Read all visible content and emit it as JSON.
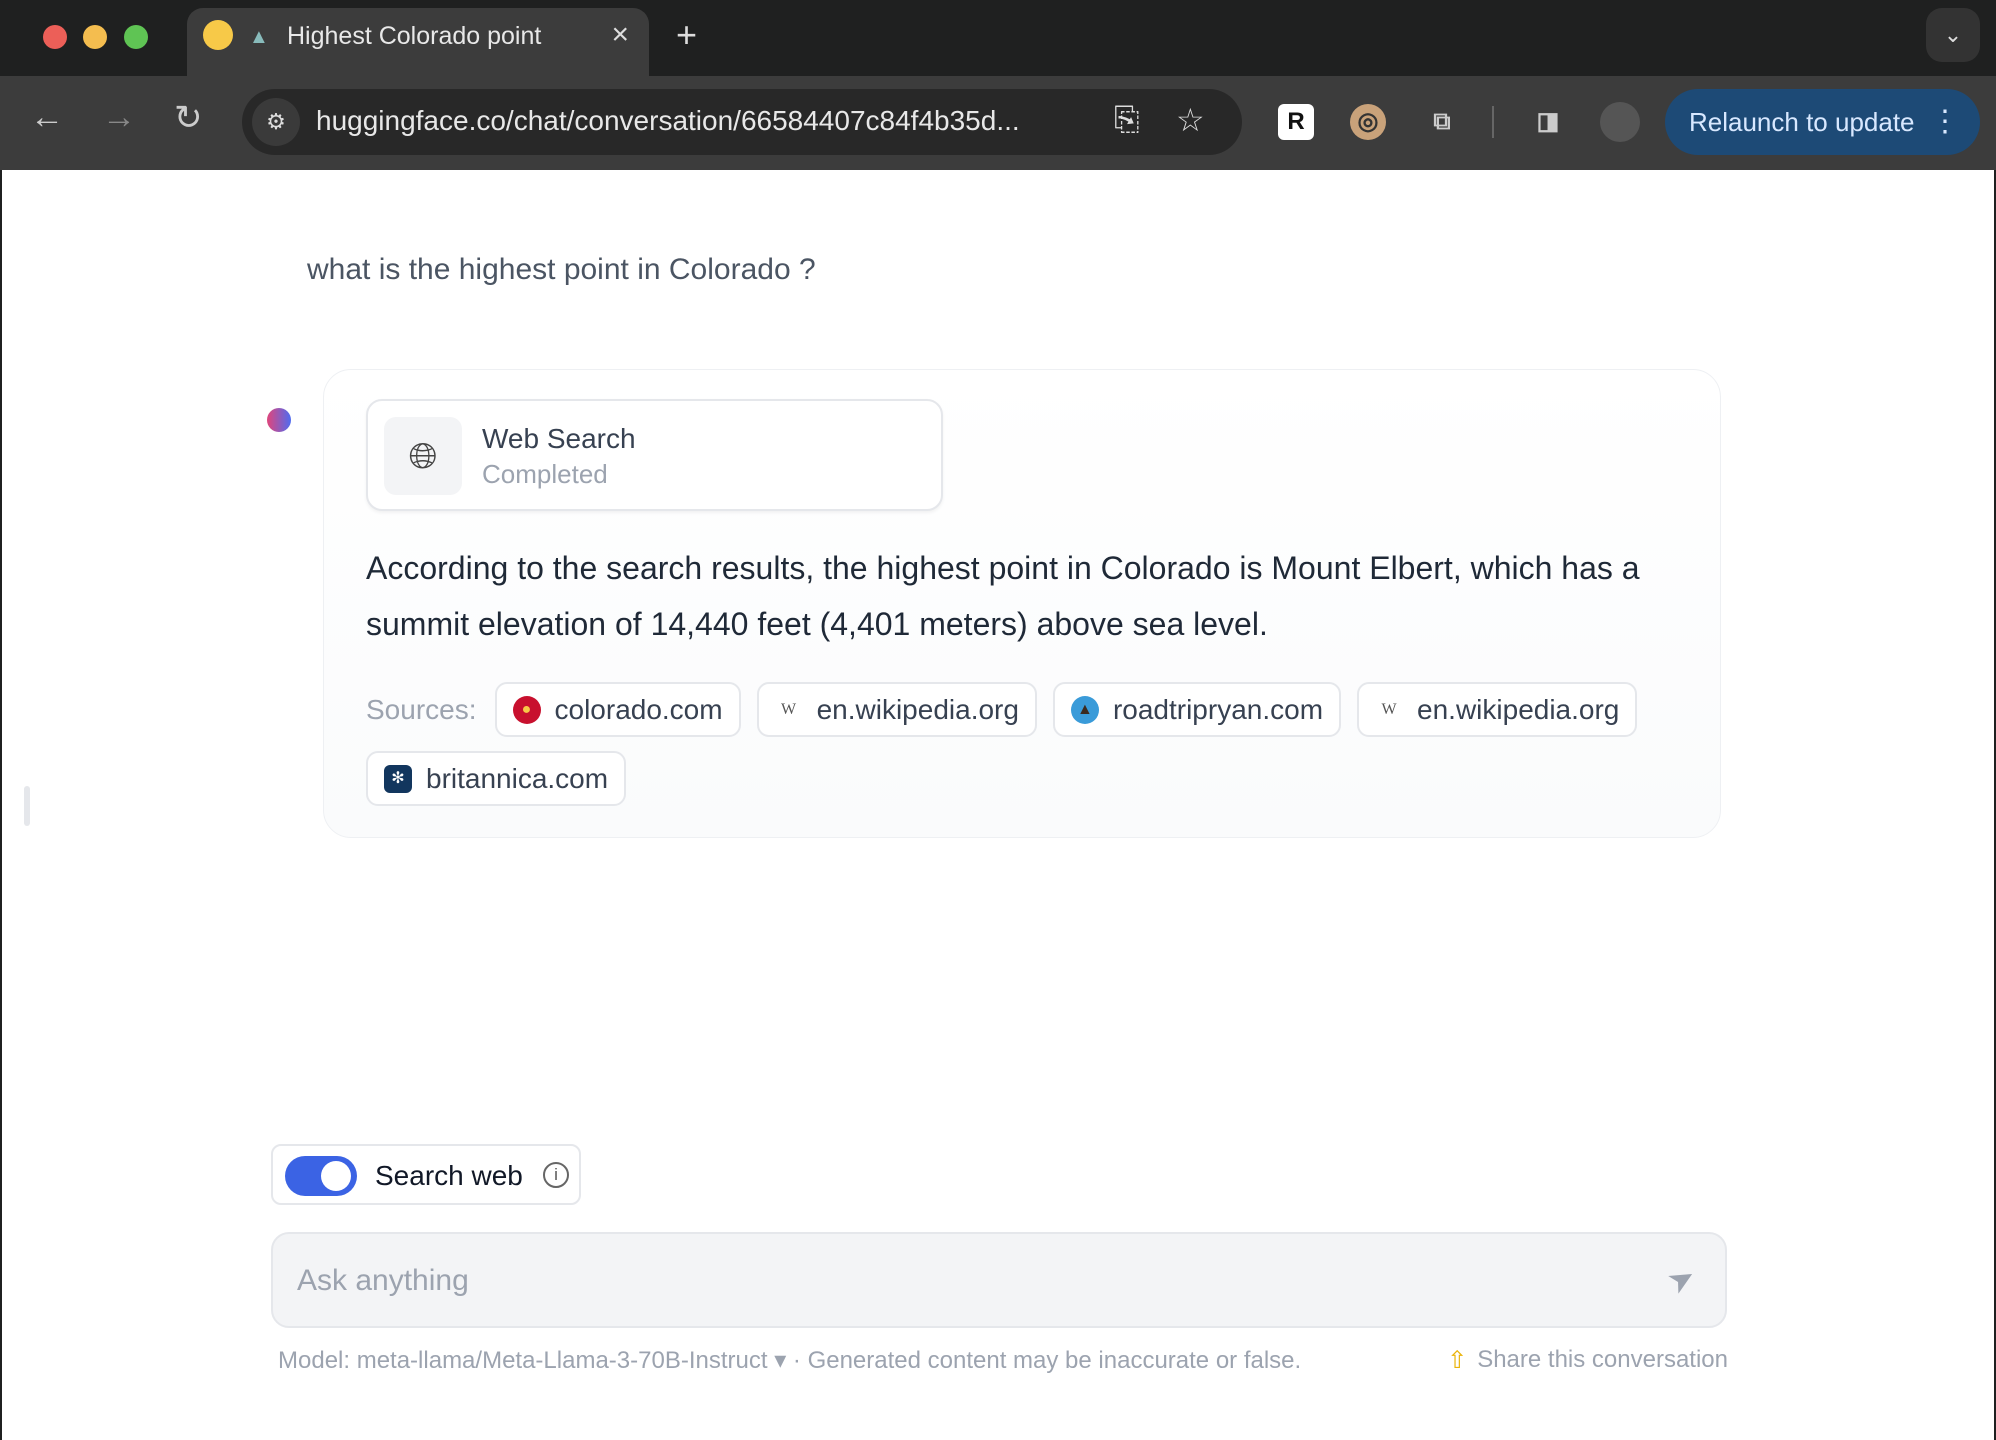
{
  "browser": {
    "tab_title": "Highest Colorado point",
    "url": "huggingface.co/chat/conversation/66584407c84f4b35d...",
    "relaunch_label": "Relaunch to update"
  },
  "chat": {
    "question": "what is the highest point in Colorado ?",
    "tool": {
      "name": "Web Search",
      "status": "Completed"
    },
    "answer": "According to the search results, the highest point in Colorado is Mount Elbert, which has a summit elevation of 14,440 feet (4,401 meters) above sea level.",
    "sources_label": "Sources:",
    "sources": [
      {
        "label": "colorado.com",
        "icon": "colorado-flag-icon"
      },
      {
        "label": "en.wikipedia.org",
        "icon": "wikipedia-icon"
      },
      {
        "label": "roadtripryan.com",
        "icon": "mountain-icon"
      },
      {
        "label": "en.wikipedia.org",
        "icon": "wikipedia-icon"
      },
      {
        "label": "britannica.com",
        "icon": "thistle-icon"
      }
    ]
  },
  "composer": {
    "search_web_label": "Search web",
    "search_web_enabled": true,
    "placeholder": "Ask anything",
    "model_label": "Model: meta-llama/Meta-Llama-3-70B-Instruct",
    "disclaimer": "· Generated content may be inaccurate or false.",
    "share_label": "Share this conversation"
  },
  "colors": {
    "accent": "#3b63e4",
    "relaunch": "#1d4a76"
  }
}
